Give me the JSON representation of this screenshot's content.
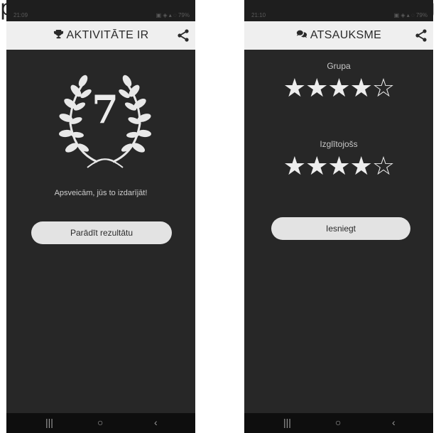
{
  "caption": {
    "left": "p",
    "right": "g"
  },
  "left_screen": {
    "status_time": "21:09",
    "status_icons": "▣ ◈ ▴ ◌ 79%",
    "title_icon": "trophy-icon",
    "title": "AKTIVITĀTE IR",
    "score": "7",
    "congrats": "Apsveicām, jūs to izdarījāt!",
    "button": "Parādīt rezultātu"
  },
  "right_screen": {
    "status_time": "21:10",
    "status_icons": "▣ ◈ ▴ ◌ 79%",
    "title_icon": "chat-bubbles-icon",
    "title": "ATSAUKSME",
    "ratings": [
      {
        "label": "Grupa",
        "value": 4,
        "max": 5
      },
      {
        "label": "Izglītojošs",
        "value": 4,
        "max": 5
      }
    ],
    "button": "Iesniegt"
  },
  "navbar": {
    "recents": "|||",
    "home": "○",
    "back": "‹"
  },
  "colors": {
    "background": "#272727",
    "topbar": "#efefef",
    "button": "#e3e3e3",
    "star": "#ededed"
  }
}
